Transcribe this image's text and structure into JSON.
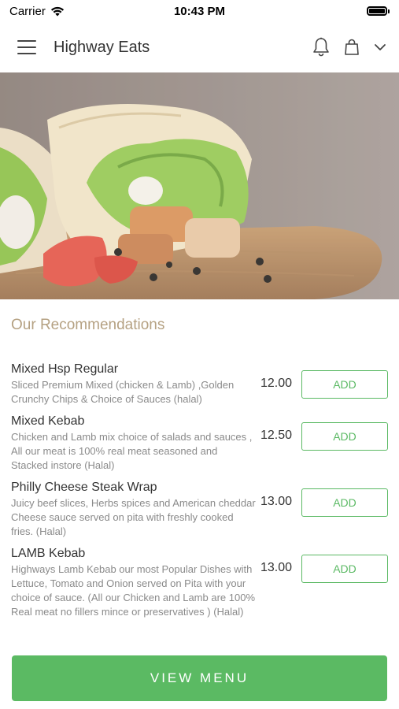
{
  "status_bar": {
    "carrier": "Carrier",
    "time": "10:43 PM"
  },
  "header": {
    "title": "Highway Eats"
  },
  "recommendations": {
    "title": "Our Recommendations",
    "items": [
      {
        "name": "Mixed Hsp Regular",
        "description": "Sliced Premium Mixed (chicken & Lamb) ,Golden Crunchy Chips & Choice of Sauces (halal)",
        "price": "12.00",
        "add_label": "ADD"
      },
      {
        "name": "Mixed Kebab",
        "description": "Chicken and Lamb mix choice of salads and sauces , All our meat is 100% real meat seasoned and Stacked instore (Halal)",
        "price": "12.50",
        "add_label": "ADD"
      },
      {
        "name": "Philly Cheese Steak Wrap",
        "description": "Juicy beef slices, Herbs spices and American cheddar Cheese sauce served on pita with freshly cooked fries. (Halal)",
        "price": "13.00",
        "add_label": "ADD"
      },
      {
        "name": "LAMB Kebab",
        "description": "Highways Lamb Kebab our most Popular Dishes with Lettuce, Tomato and Onion served on Pita with your choice of sauce. (All our Chicken and Lamb are 100% Real meat no fillers mince or preservatives ) (Halal)",
        "price": "13.00",
        "add_label": "ADD"
      }
    ]
  },
  "footer": {
    "view_menu_label": "VIEW MENU"
  },
  "colors": {
    "accent_green": "#5bba63",
    "section_title": "#b5a182"
  },
  "icons": [
    "wifi-icon",
    "battery-icon",
    "menu-icon",
    "bell-icon",
    "shopping-bag-icon",
    "chevron-down-icon"
  ]
}
